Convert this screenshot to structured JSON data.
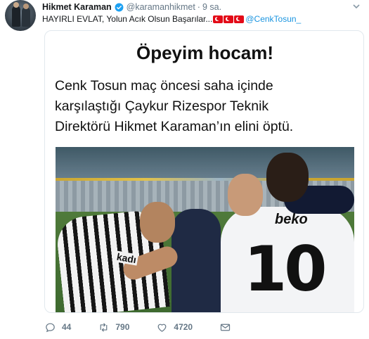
{
  "tweet": {
    "display_name": "Hikmet Karaman",
    "handle": "@karamanhikmet",
    "separator": "·",
    "time": "9 sa.",
    "text": "HAYIRLI EVLAT, Yolun Acık Olsun Başarılar...",
    "flags": [
      "turkey-flag",
      "turkey-flag",
      "turkey-flag"
    ],
    "mention": "@CenkTosun_"
  },
  "media": {
    "headline": "Öpeyim hocam!",
    "lines": [
      "Cenk Tosun maç öncesi saha içinde",
      "karşılaştığı Çaykur Rizespor Teknik",
      "Direktörü Hikmet Karaman’ın elini öptü."
    ],
    "photo_jersey_number": "10",
    "photo_sponsor": "beko",
    "photo_kit_text": "kadı"
  },
  "actions": {
    "reply_count": "44",
    "retweet_count": "790",
    "like_count": "4720"
  },
  "colors": {
    "link": "#1b95e0",
    "muted": "#657786",
    "verified": "#1da1f2",
    "flag": "#e30a17"
  }
}
